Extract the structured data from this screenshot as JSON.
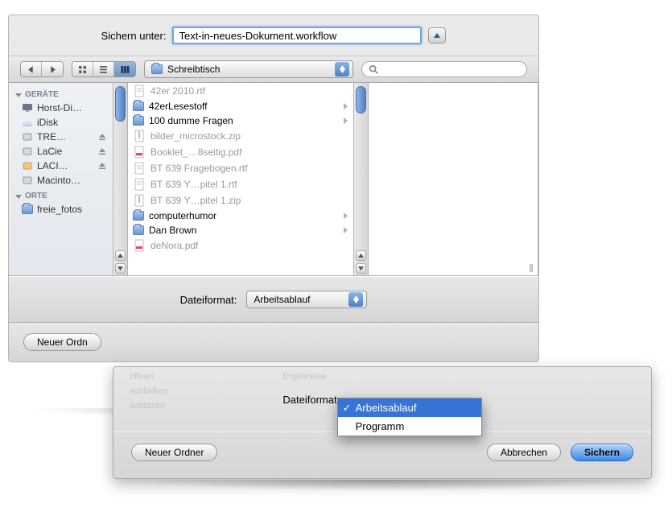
{
  "save": {
    "label": "Sichern unter:",
    "filename": "Text-in-neues-Dokument.workflow"
  },
  "toolbar": {
    "location": "Schreibtisch"
  },
  "sidebar": {
    "devices_header": "GERÄTE",
    "places_header": "ORTE",
    "devices": [
      {
        "name": "Horst-Di…",
        "icon": "imac"
      },
      {
        "name": "iDisk",
        "icon": "idisk"
      },
      {
        "name": "TRE…",
        "icon": "hdd",
        "eject": true
      },
      {
        "name": "LaCie",
        "icon": "hdd",
        "eject": true
      },
      {
        "name": "LACI…",
        "icon": "ext",
        "eject": true
      },
      {
        "name": "Macinto…",
        "icon": "hdd"
      }
    ],
    "places": [
      {
        "name": "freie_fotos",
        "icon": "folder"
      }
    ]
  },
  "files": [
    {
      "name": "42er 2010.rtf",
      "type": "doc",
      "dim": true
    },
    {
      "name": "42erLesestoff",
      "type": "folder",
      "dim": false,
      "arrow": true
    },
    {
      "name": "100 dumme Fragen",
      "type": "folder",
      "dim": false,
      "arrow": true
    },
    {
      "name": "bilder_microstock.zip",
      "type": "zip",
      "dim": true
    },
    {
      "name": "Booklet_…8seitig.pdf",
      "type": "pdf",
      "dim": true
    },
    {
      "name": "BT 639 Fragebogen.rtf",
      "type": "doc",
      "dim": true
    },
    {
      "name": "BT 639 Y…pitel 1.rtf",
      "type": "doc",
      "dim": true
    },
    {
      "name": "BT 639 Y…pitel 1.zip",
      "type": "zip",
      "dim": true
    },
    {
      "name": "computerhumor",
      "type": "folder",
      "dim": false,
      "arrow": true
    },
    {
      "name": "Dan Brown",
      "type": "folder",
      "dim": false,
      "arrow": true
    },
    {
      "name": "deNora.pdf",
      "type": "pdf",
      "dim": true
    }
  ],
  "format": {
    "label": "Dateiformat:",
    "value": "Arbeitsablauf",
    "options": [
      "Arbeitsablauf",
      "Programm"
    ]
  },
  "buttons": {
    "newfolder": "Neuer Ordner",
    "newfolder_cut": "Neuer Ordn",
    "cancel": "Abbrechen",
    "save": "Sichern"
  },
  "overlay": {
    "format_label": "Dateiformat"
  }
}
